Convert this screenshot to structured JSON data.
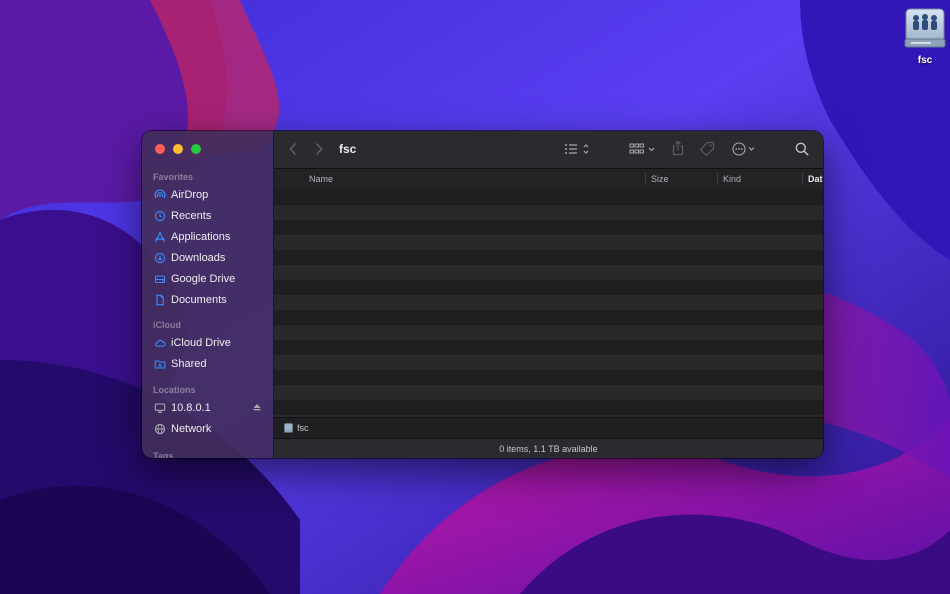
{
  "desktop": {
    "icon_label": "fsc"
  },
  "window": {
    "title": "fsc",
    "sidebar": {
      "favorites": {
        "heading": "Favorites",
        "items": [
          {
            "label": "AirDrop",
            "icon": "airdrop-icon"
          },
          {
            "label": "Recents",
            "icon": "clock-icon"
          },
          {
            "label": "Applications",
            "icon": "applications-icon"
          },
          {
            "label": "Downloads",
            "icon": "download-icon"
          },
          {
            "label": "Google Drive",
            "icon": "drive-icon"
          },
          {
            "label": "Documents",
            "icon": "document-icon"
          }
        ]
      },
      "icloud": {
        "heading": "iCloud",
        "items": [
          {
            "label": "iCloud Drive",
            "icon": "cloud-icon"
          },
          {
            "label": "Shared",
            "icon": "shared-folder-icon"
          }
        ]
      },
      "locations": {
        "heading": "Locations",
        "items": [
          {
            "label": "10.8.0.1",
            "icon": "display-icon"
          },
          {
            "label": "Network",
            "icon": "globe-icon"
          }
        ]
      },
      "tags": {
        "heading": "Tags"
      }
    },
    "columns": {
      "name": "Name",
      "size": "Size",
      "kind": "Kind",
      "date": "Dat"
    },
    "path_bar": {
      "label": "fsc"
    },
    "status_bar": {
      "text": "0 items, 1.1 TB available"
    }
  },
  "colors": {
    "accent": "#3d8bfd",
    "close": "#fe5f57",
    "minimize": "#febc2e",
    "zoom": "#28c840"
  }
}
